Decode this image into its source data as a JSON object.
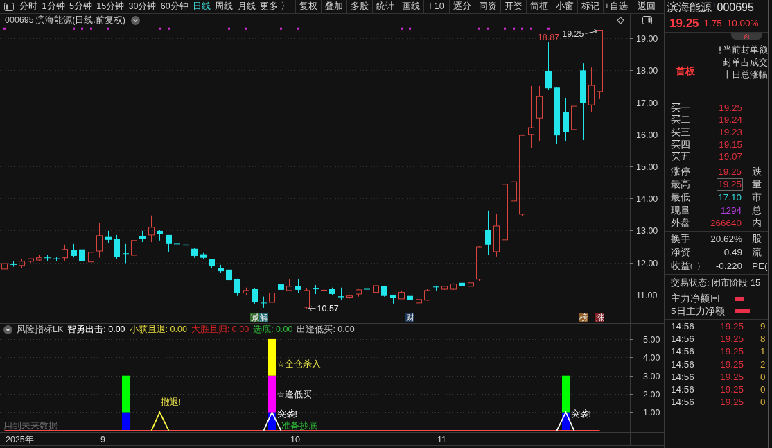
{
  "toolbar": {
    "periods": [
      {
        "label": "分时",
        "selected": false
      },
      {
        "label": "1分钟",
        "selected": false
      },
      {
        "label": "5分钟",
        "selected": false
      },
      {
        "label": "15分钟",
        "selected": false
      },
      {
        "label": "30分钟",
        "selected": false
      },
      {
        "label": "60分钟",
        "selected": false
      },
      {
        "label": "日线",
        "selected": true
      },
      {
        "label": "周线",
        "selected": false
      },
      {
        "label": "月线",
        "selected": false
      },
      {
        "label": "更多 〉",
        "selected": false
      }
    ],
    "tools": [
      "复权",
      "叠加",
      "多股",
      "统计",
      "画线",
      "F10",
      "逐分",
      "同资",
      "开资",
      "简框",
      "小窗",
      "标记",
      "+自选",
      "返回"
    ]
  },
  "chart_header": {
    "title": "000695 滨海能源(日线.前复权)"
  },
  "main_chart": {
    "chart_data": {
      "type": "candlestick",
      "categories": [
        null,
        null,
        null,
        null,
        null,
        null,
        null,
        null,
        null,
        null,
        null,
        null,
        null,
        null,
        null,
        null,
        null,
        null,
        null,
        null,
        null,
        null,
        null,
        null,
        null,
        null,
        null,
        null,
        null,
        null,
        null,
        null,
        null,
        null,
        null,
        null,
        null,
        null,
        null,
        null,
        null,
        null,
        null,
        null,
        null,
        null,
        null,
        null,
        null,
        null,
        null,
        null,
        null,
        null,
        null,
        null,
        null,
        null,
        null,
        null,
        null,
        null,
        null,
        null,
        null,
        null,
        null,
        null,
        null,
        null,
        null,
        null,
        null
      ],
      "ohlc": [
        [
          11.8,
          11.98,
          11.8,
          11.97
        ],
        [
          11.97,
          12.04,
          11.87,
          11.93
        ],
        [
          11.91,
          12.1,
          11.82,
          12.04
        ],
        [
          12.04,
          12.13,
          12.0,
          12.12
        ],
        [
          12.08,
          12.23,
          12.06,
          12.15
        ],
        [
          12.16,
          12.23,
          12.04,
          12.14
        ],
        [
          12.13,
          12.17,
          12.04,
          12.12
        ],
        [
          12.15,
          12.56,
          12.06,
          12.41
        ],
        [
          12.39,
          12.58,
          12.16,
          12.21
        ],
        [
          12.41,
          12.47,
          11.71,
          12.04
        ],
        [
          12.02,
          12.54,
          11.87,
          12.32
        ],
        [
          12.36,
          13.23,
          12.15,
          12.84
        ],
        [
          12.8,
          12.99,
          12.6,
          12.71
        ],
        [
          12.73,
          12.86,
          12.12,
          12.17
        ],
        [
          12.29,
          12.58,
          11.98,
          12.27
        ],
        [
          12.23,
          12.91,
          12.23,
          12.69
        ],
        [
          12.82,
          12.99,
          12.64,
          12.73
        ],
        [
          12.86,
          13.47,
          12.64,
          13.1
        ],
        [
          12.99,
          13.03,
          12.69,
          12.88
        ],
        [
          12.86,
          12.86,
          12.34,
          12.58
        ],
        [
          12.59,
          12.59,
          12.34,
          12.57
        ],
        [
          12.56,
          12.86,
          12.47,
          12.53
        ],
        [
          12.43,
          12.45,
          12.15,
          12.21
        ],
        [
          12.26,
          12.3,
          12.12,
          12.15
        ],
        [
          12.1,
          12.12,
          11.82,
          11.89
        ],
        [
          11.84,
          11.93,
          11.68,
          11.73
        ],
        [
          11.78,
          11.8,
          11.37,
          11.45
        ],
        [
          11.48,
          11.5,
          10.96,
          11.05
        ],
        [
          11.05,
          11.22,
          10.98,
          11.13
        ],
        [
          11.17,
          11.19,
          10.72,
          10.78
        ],
        [
          10.75,
          10.94,
          10.59,
          10.73
        ],
        [
          10.76,
          11.19,
          10.76,
          11.05
        ],
        [
          11.32,
          11.33,
          11.07,
          11.15
        ],
        [
          11.13,
          11.48,
          11.13,
          11.26
        ],
        [
          11.26,
          11.48,
          11.05,
          11.15
        ],
        [
          10.61,
          11.2,
          10.57,
          11.13
        ],
        [
          11.19,
          11.3,
          11.02,
          11.17
        ],
        [
          11.12,
          11.2,
          11.05,
          11.14
        ],
        [
          11.17,
          11.22,
          10.98,
          11.02
        ],
        [
          10.95,
          11.22,
          10.83,
          10.92
        ],
        [
          10.92,
          11.0,
          10.88,
          10.96
        ],
        [
          11.02,
          11.17,
          10.94,
          11.15
        ],
        [
          11.18,
          11.26,
          11.05,
          11.16
        ],
        [
          11.07,
          11.3,
          11.02,
          11.28
        ],
        [
          11.26,
          11.28,
          10.94,
          10.96
        ],
        [
          10.98,
          11.0,
          10.72,
          10.89
        ],
        [
          10.87,
          11.13,
          10.87,
          11.07
        ],
        [
          10.96,
          11.02,
          10.65,
          10.83
        ],
        [
          10.74,
          10.87,
          10.72,
          10.85
        ],
        [
          10.83,
          11.17,
          10.81,
          11.13
        ],
        [
          11.25,
          11.28,
          11.13,
          11.23
        ],
        [
          11.17,
          11.28,
          11.15,
          11.26
        ],
        [
          11.17,
          11.35,
          11.15,
          11.33
        ],
        [
          11.37,
          11.41,
          11.22,
          11.26
        ],
        [
          11.26,
          11.41,
          11.22,
          11.37
        ],
        [
          11.48,
          12.51,
          11.43,
          12.49
        ],
        [
          13.03,
          13.62,
          12.23,
          12.56
        ],
        [
          12.34,
          13.51,
          12.19,
          13.14
        ],
        [
          12.71,
          14.46,
          12.69,
          14.44
        ],
        [
          13.92,
          14.81,
          13.68,
          14.52
        ],
        [
          13.51,
          16.0,
          13.45,
          15.97
        ],
        [
          16.0,
          17.51,
          15.58,
          16.21
        ],
        [
          16.51,
          17.51,
          15.8,
          17.18
        ],
        [
          17.98,
          18.87,
          17.38,
          17.44
        ],
        [
          17.46,
          17.46,
          15.69,
          15.97
        ],
        [
          16.69,
          17.14,
          15.8,
          16.08
        ],
        [
          16.15,
          17.34,
          15.8,
          16.88
        ],
        [
          18.0,
          18.22,
          15.82,
          16.99
        ],
        [
          16.92,
          18.09,
          16.71,
          17.53
        ],
        [
          17.34,
          19.25,
          17.1,
          19.25
        ],
        null,
        null,
        null
      ],
      "ylim": [
        10.11,
        19.37
      ],
      "yticks": [
        {
          "value": 19,
          "label": "19.00"
        },
        {
          "value": 18,
          "label": "18.00"
        },
        {
          "value": 17,
          "label": "17.00"
        },
        {
          "value": 16,
          "label": "16.00"
        },
        {
          "value": 15,
          "label": "15.00"
        },
        {
          "value": 14,
          "label": "14.00"
        },
        {
          "value": 13,
          "label": "13.00"
        },
        {
          "value": 12,
          "label": "12.00"
        },
        {
          "value": 11,
          "label": "11.00"
        }
      ],
      "grid": true,
      "series": [
        {
          "type": "scatter",
          "color": "#d42ad4",
          "values": [
            19.3,
            null,
            null,
            null,
            null,
            null,
            null,
            null,
            19.3,
            19.3,
            19.3,
            null,
            19.3,
            null,
            null,
            null,
            null,
            null,
            19.3,
            19.3,
            null,
            null,
            null,
            null,
            null,
            null,
            19.3,
            null,
            19.3,
            null,
            null,
            null,
            19.3,
            null,
            19.3,
            null,
            null,
            null,
            null,
            null,
            null,
            null,
            null,
            null,
            null,
            null,
            19.3,
            19.3,
            null,
            null,
            null,
            null,
            null,
            null,
            null,
            19.3,
            19.3,
            null,
            19.3,
            19.3,
            19.3,
            19.3,
            null,
            19.3,
            null,
            null,
            null,
            null,
            null,
            null,
            null,
            null,
            null
          ]
        }
      ],
      "annotations": [
        "19.25",
        "18.87",
        "10.57"
      ]
    },
    "event_tags": [
      {
        "text": "减",
        "color": "#356a2c"
      },
      {
        "text": "解",
        "color": "#226a72"
      },
      {
        "text": "财",
        "color": "#1d3558"
      },
      {
        "text": "榜",
        "color": "#8c5a22"
      },
      {
        "text": "涨",
        "color": "#7e1c22"
      }
    ]
  },
  "indicator": {
    "name": "风险指标LK",
    "legend": [
      {
        "text": "智勇出击: 0.00",
        "color": "#ffffff"
      },
      {
        "text": "小获且退: 0.00",
        "color": "#e6dc3c"
      },
      {
        "text": "大胜且归: 0.00",
        "color": "#e02424"
      },
      {
        "text": "选底: 0.00",
        "color": "#2fbf3a"
      },
      {
        "text": "出逢低买: 0.00",
        "color": "#c8c8c8"
      }
    ],
    "note": "用到未来数据",
    "chart_data": {
      "type": "bar",
      "stacked": true,
      "grid": true,
      "categories": [
        null,
        null,
        null,
        null,
        null,
        null,
        null,
        null,
        null,
        null,
        null,
        null,
        null,
        null,
        null,
        null,
        null,
        null,
        null,
        null,
        null,
        null,
        null,
        null,
        null,
        null,
        null,
        null,
        null,
        null,
        null,
        null,
        null,
        null,
        null,
        null,
        null,
        null,
        null,
        null,
        null,
        null,
        null,
        null,
        null,
        null,
        null,
        null,
        null,
        null,
        null,
        null,
        null,
        null,
        null,
        null,
        null,
        null,
        null,
        null,
        null,
        null,
        null,
        null,
        null,
        null,
        null,
        null,
        null,
        null,
        null,
        null,
        null
      ],
      "ylim": [
        -0.08,
        5.83
      ],
      "yticks": [
        {
          "value": 5,
          "label": "5.00"
        },
        {
          "value": 4,
          "label": "4.00"
        },
        {
          "value": 3,
          "label": "3.00"
        },
        {
          "value": 2,
          "label": "2.00"
        },
        {
          "value": 1,
          "label": "1.00"
        }
      ],
      "series": [
        {
          "color": "#0000ff",
          "values": [
            null,
            null,
            null,
            null,
            null,
            null,
            null,
            null,
            null,
            null,
            null,
            null,
            null,
            null,
            1,
            null,
            null,
            null,
            null,
            null,
            null,
            null,
            null,
            null,
            null,
            null,
            null,
            null,
            null,
            null,
            null,
            1,
            null,
            null,
            null,
            null,
            null,
            null,
            null,
            null,
            null,
            null,
            null,
            null,
            null,
            null,
            null,
            null,
            null,
            null,
            null,
            null,
            null,
            null,
            null,
            null,
            null,
            null,
            null,
            null,
            null,
            null,
            null,
            null,
            null,
            1,
            null,
            null,
            null,
            null,
            null,
            null,
            null
          ]
        },
        {
          "color": "#00ff00",
          "values": [
            null,
            null,
            null,
            null,
            null,
            null,
            null,
            null,
            null,
            null,
            null,
            null,
            null,
            null,
            2,
            null,
            null,
            null,
            null,
            null,
            null,
            null,
            null,
            null,
            null,
            null,
            null,
            null,
            null,
            null,
            null,
            null,
            null,
            null,
            null,
            null,
            null,
            null,
            null,
            null,
            null,
            null,
            null,
            null,
            null,
            null,
            null,
            null,
            null,
            null,
            null,
            null,
            null,
            null,
            null,
            null,
            null,
            null,
            null,
            null,
            null,
            null,
            null,
            null,
            null,
            2,
            null,
            null,
            null,
            null,
            null,
            null,
            null
          ]
        },
        {
          "color": "#ff00ff",
          "values": [
            null,
            null,
            null,
            null,
            null,
            null,
            null,
            null,
            null,
            null,
            null,
            null,
            null,
            null,
            null,
            null,
            null,
            null,
            null,
            null,
            null,
            null,
            null,
            null,
            null,
            null,
            null,
            null,
            null,
            null,
            null,
            2,
            null,
            null,
            null,
            null,
            null,
            null,
            null,
            null,
            null,
            null,
            null,
            null,
            null,
            null,
            null,
            null,
            null,
            null,
            null,
            null,
            null,
            null,
            null,
            null,
            null,
            null,
            null,
            null,
            null,
            null,
            null,
            null,
            null,
            null,
            null,
            null,
            null,
            null,
            null,
            null,
            null
          ]
        },
        {
          "color": "#ffff00",
          "values": [
            null,
            null,
            null,
            null,
            null,
            null,
            null,
            null,
            null,
            null,
            null,
            null,
            null,
            null,
            null,
            null,
            null,
            null,
            null,
            null,
            null,
            null,
            null,
            null,
            null,
            null,
            null,
            null,
            null,
            null,
            null,
            2,
            null,
            null,
            null,
            null,
            null,
            null,
            null,
            null,
            null,
            null,
            null,
            null,
            null,
            null,
            null,
            null,
            null,
            null,
            null,
            null,
            null,
            null,
            null,
            null,
            null,
            null,
            null,
            null,
            null,
            null,
            null,
            null,
            null,
            null,
            null,
            null,
            null,
            null,
            null,
            null,
            null
          ]
        },
        {
          "type": "line",
          "color": "#ff4848",
          "values": [
            0,
            0,
            0,
            0,
            0,
            0,
            0,
            0,
            0,
            0,
            0,
            0,
            0,
            0,
            0,
            0,
            0,
            0,
            0,
            0,
            0,
            0,
            0,
            0,
            0,
            0,
            0,
            0,
            0,
            0,
            0,
            0,
            0,
            0,
            0,
            0,
            0,
            0,
            0,
            0,
            0,
            0,
            0,
            0,
            0,
            0,
            0,
            0,
            0,
            0,
            0,
            0,
            0,
            0,
            0,
            0,
            0,
            0,
            0,
            0,
            0,
            0,
            0,
            0,
            0,
            0,
            0,
            0,
            0,
            0,
            null,
            null,
            null
          ]
        },
        {
          "type": "line",
          "color": "#ffff40",
          "values": [
            null,
            null,
            null,
            null,
            null,
            null,
            null,
            null,
            null,
            null,
            null,
            null,
            null,
            null,
            null,
            null,
            null,
            0,
            1,
            0,
            null,
            null,
            null,
            null,
            null,
            null,
            null,
            null,
            null,
            null,
            null,
            null,
            null,
            null,
            null,
            null,
            null,
            null,
            null,
            null,
            null,
            null,
            null,
            null,
            null,
            null,
            null,
            null,
            null,
            null,
            null,
            null,
            null,
            null,
            null,
            null,
            null,
            null,
            null,
            null,
            null,
            null,
            null,
            null,
            null,
            null,
            null,
            null,
            null,
            null,
            null,
            null,
            null
          ]
        },
        {
          "type": "line",
          "color": "#ffffff",
          "values": [
            null,
            null,
            null,
            null,
            null,
            null,
            null,
            null,
            null,
            null,
            null,
            null,
            null,
            null,
            null,
            null,
            null,
            null,
            null,
            null,
            null,
            null,
            null,
            null,
            null,
            null,
            null,
            null,
            null,
            null,
            0,
            1,
            0,
            null,
            null,
            null,
            null,
            null,
            null,
            null,
            null,
            null,
            null,
            null,
            null,
            null,
            null,
            null,
            null,
            null,
            null,
            null,
            null,
            null,
            null,
            null,
            null,
            null,
            null,
            null,
            null,
            null,
            null,
            null,
            0,
            1,
            0,
            null,
            null,
            null,
            null,
            null,
            null
          ]
        }
      ],
      "annotations": [
        "撤退!",
        "☆全仓杀入",
        "☆逢低买",
        "突袭!",
        "准备抄底",
        "突袭!"
      ]
    }
  },
  "time_axis": {
    "labels": [
      "2025年",
      "9",
      "10",
      "11"
    ]
  },
  "quote_panel": {
    "name": "滨海能源",
    "tag": "T",
    "code": "000695",
    "price": "19.25",
    "change": "1.75",
    "change_pct": "10.00%",
    "board": "首板",
    "notes": [
      {
        "text": "当前封单额",
        "alert": true
      },
      {
        "text": "封单占成交",
        "alert": false
      },
      {
        "text": "十日总涨幅",
        "alert": false
      }
    ],
    "bids": [
      {
        "label": "买一",
        "price": "19.25"
      },
      {
        "label": "买二",
        "price": "19.24"
      },
      {
        "label": "买三",
        "price": "19.23"
      },
      {
        "label": "买四",
        "price": "19.15"
      },
      {
        "label": "买五",
        "price": "19.07"
      }
    ],
    "stats": [
      {
        "label": "涨停",
        "value": "19.25",
        "color": "#e0303c",
        "boxed": false,
        "label2": "跌"
      },
      {
        "label": "最高",
        "value": "19.25",
        "color": "#e0303c",
        "boxed": true,
        "label2": "量"
      },
      {
        "label": "最低",
        "value": "17.10",
        "color": "#33d6d6",
        "boxed": false,
        "label2": "市"
      },
      {
        "label": "现量",
        "value": "1294",
        "color": "#b43ee0",
        "boxed": false,
        "label2": "总"
      },
      {
        "label": "外盘",
        "value": "266640",
        "color": "#e0303c",
        "boxed": false,
        "label2": "内"
      }
    ],
    "fundamentals": [
      {
        "label": "换手",
        "value": "20.62%",
        "label2": "股"
      },
      {
        "label": "净资",
        "value": "0.49",
        "label2": "流"
      },
      {
        "label": "收益㈢",
        "value": "-0.220",
        "label2": "PE("
      }
    ],
    "status": "交易状态: 闭市阶段 15",
    "net_flow": [
      {
        "label": "主力净额",
        "detail_icon": true
      },
      {
        "label": "5日主力净额",
        "detail_icon": false
      }
    ],
    "trades": [
      {
        "time": "14:56",
        "price": "19.25",
        "volume": "9"
      },
      {
        "time": "14:56",
        "price": "19.25",
        "volume": "8"
      },
      {
        "time": "14:56",
        "price": "19.25",
        "volume": "1"
      },
      {
        "time": "14:56",
        "price": "19.25",
        "volume": "2"
      },
      {
        "time": "14:56",
        "price": "19.25",
        "volume": "0"
      },
      {
        "time": "14:56",
        "price": "19.25",
        "volume": "0"
      },
      {
        "time": "14:56",
        "price": "19.25",
        "volume": "0"
      }
    ]
  }
}
